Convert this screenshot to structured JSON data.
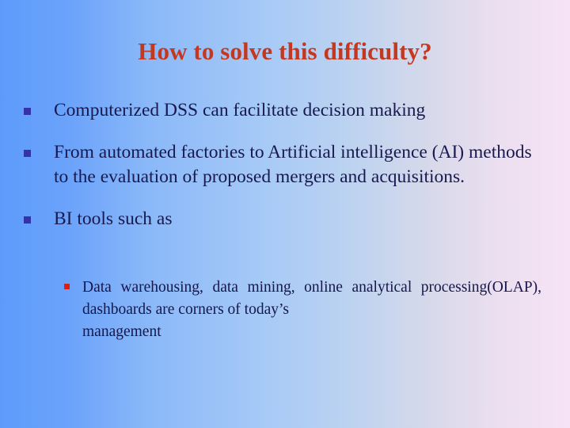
{
  "slide": {
    "title": "How to solve this difficulty?",
    "title_color": "#c4381f",
    "text_color": "#18194e",
    "background_start_color": "#5d9bfb",
    "background_end_color": "#f6e3f6",
    "bullet_marker_color_level1": "#3434a8",
    "bullet_marker_color_level2": "#d91f16",
    "bullets": [
      {
        "level": 1,
        "text": "Computerized DSS can facilitate decision making"
      },
      {
        "level": 1,
        "text": "From automated factories to Artificial intelligence (AI) methods to the evaluation of proposed mergers and acquisitions."
      },
      {
        "level": 1,
        "text": "BI tools such as"
      }
    ],
    "sub_bullets": [
      {
        "level": 2,
        "text": "Data warehousing, data mining, online analytical processing(OLAP), dashboards are corners of today’s",
        "last_line": "management"
      }
    ]
  }
}
